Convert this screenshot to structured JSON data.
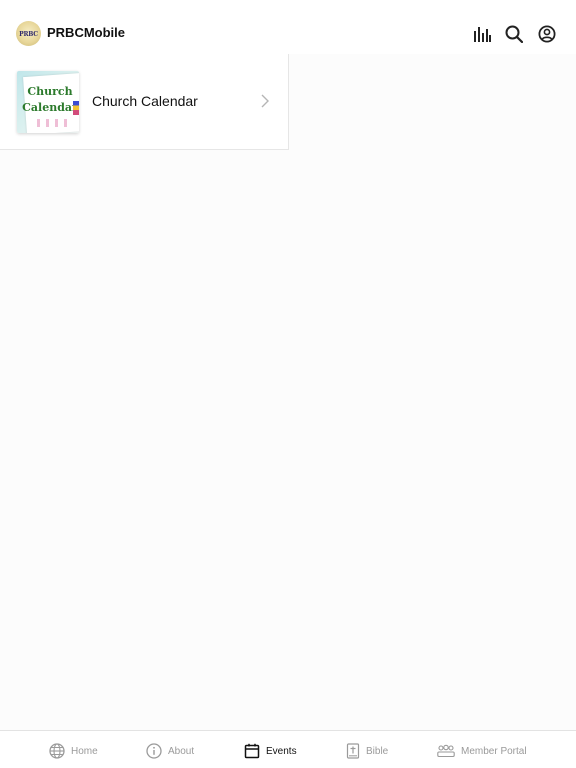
{
  "header": {
    "app_title": "PRBCMobile",
    "logo_text": "PRBC",
    "actions": [
      {
        "icon": "equalizer-icon"
      },
      {
        "icon": "search-icon"
      },
      {
        "icon": "account-icon"
      }
    ]
  },
  "list": {
    "items": [
      {
        "label": "Church Calendar",
        "thumbnail_text": [
          "Church",
          "Calendar"
        ],
        "icon": "chevron-right-icon"
      }
    ]
  },
  "tabbar": {
    "active": "Events",
    "tabs": [
      {
        "label": "Home",
        "icon": "globe-icon"
      },
      {
        "label": "About",
        "icon": "info-icon"
      },
      {
        "label": "Events",
        "icon": "calendar-icon"
      },
      {
        "label": "Bible",
        "icon": "bible-icon"
      },
      {
        "label": "Member Portal",
        "icon": "group-icon"
      }
    ]
  },
  "colors": {
    "active_tab": "#111111",
    "inactive_tab": "#9a9a9a",
    "thumbnail_text": "#2c7a2c"
  }
}
